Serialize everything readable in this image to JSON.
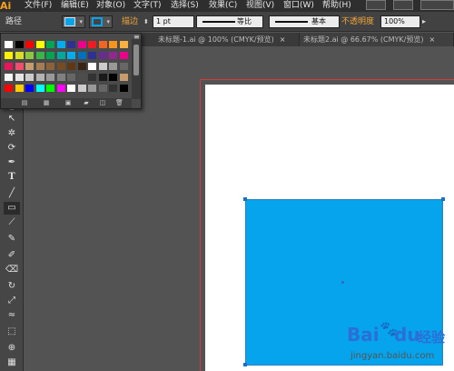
{
  "app": {
    "logo": "Ai"
  },
  "menu": [
    "文件(F)",
    "编辑(E)",
    "对象(O)",
    "文字(T)",
    "选择(S)",
    "效果(C)",
    "视图(V)",
    "窗口(W)",
    "帮助(H)"
  ],
  "control_bar": {
    "object_type": "路径",
    "fill_color": "#05a4ec",
    "stroke_label": "描边",
    "stroke_weight": "1 pt",
    "profile_label": "等比",
    "brush_label": "基本",
    "opacity_label": "不透明度",
    "opacity_value": "100%"
  },
  "tabs": [
    {
      "label": "未标题-1.ai @ 100% (CMYK/预览)",
      "close": "×"
    },
    {
      "label": "未标题2.ai @ 66.67% (CMYK/预览)",
      "close": "×"
    }
  ],
  "swatch_panel": {
    "menu_glyph": "≡",
    "swatch_colors": [
      [
        "#ffffff",
        "#000000",
        "#ff0000",
        "#ffff00",
        "#00a651",
        "#00aeef",
        "#2e3192",
        "#ec008c",
        "#ed1c24",
        "#f26522",
        "#f7941d",
        "#fbb040"
      ],
      [
        "#fff200",
        "#d7df23",
        "#8dc63f",
        "#39b54a",
        "#00a651",
        "#00a99d",
        "#00aeef",
        "#0072bc",
        "#2e3192",
        "#662d91",
        "#92278f",
        "#ec008c"
      ],
      [
        "#ed145b",
        "#f04e6d",
        "#c69c6d",
        "#a67c52",
        "#8c6239",
        "#754c24",
        "#603813",
        "#3c2415",
        "#ffffff",
        "#cccccc",
        "#999999",
        "#666666"
      ],
      [
        "#f7f7f7",
        "#e6e6e6",
        "#cccccc",
        "#b3b3b3",
        "#999999",
        "#808080",
        "#666666",
        "#4d4d4d",
        "#333333",
        "#1a1a1a",
        "#000000",
        "#c69c6d"
      ],
      [
        "#ff0000",
        "#ffcc00",
        "#0000ff",
        "#00ffff",
        "#00ff00",
        "#ff00ff",
        "#ffffff",
        "#cccccc",
        "#999999",
        "#666666",
        "#333333",
        "#000000"
      ]
    ],
    "footer_icons": [
      "swatch-library-icon",
      "show-kinds-icon",
      "swatch-options-icon",
      "new-color-group-icon",
      "new-swatch-icon",
      "delete-swatch-icon"
    ]
  },
  "artwork": {
    "rect_fill": "#05a4ec"
  },
  "watermark": {
    "brand": "Bai",
    "brand2": "du",
    "product": "经验",
    "url": "jingyan.baidu.com"
  }
}
